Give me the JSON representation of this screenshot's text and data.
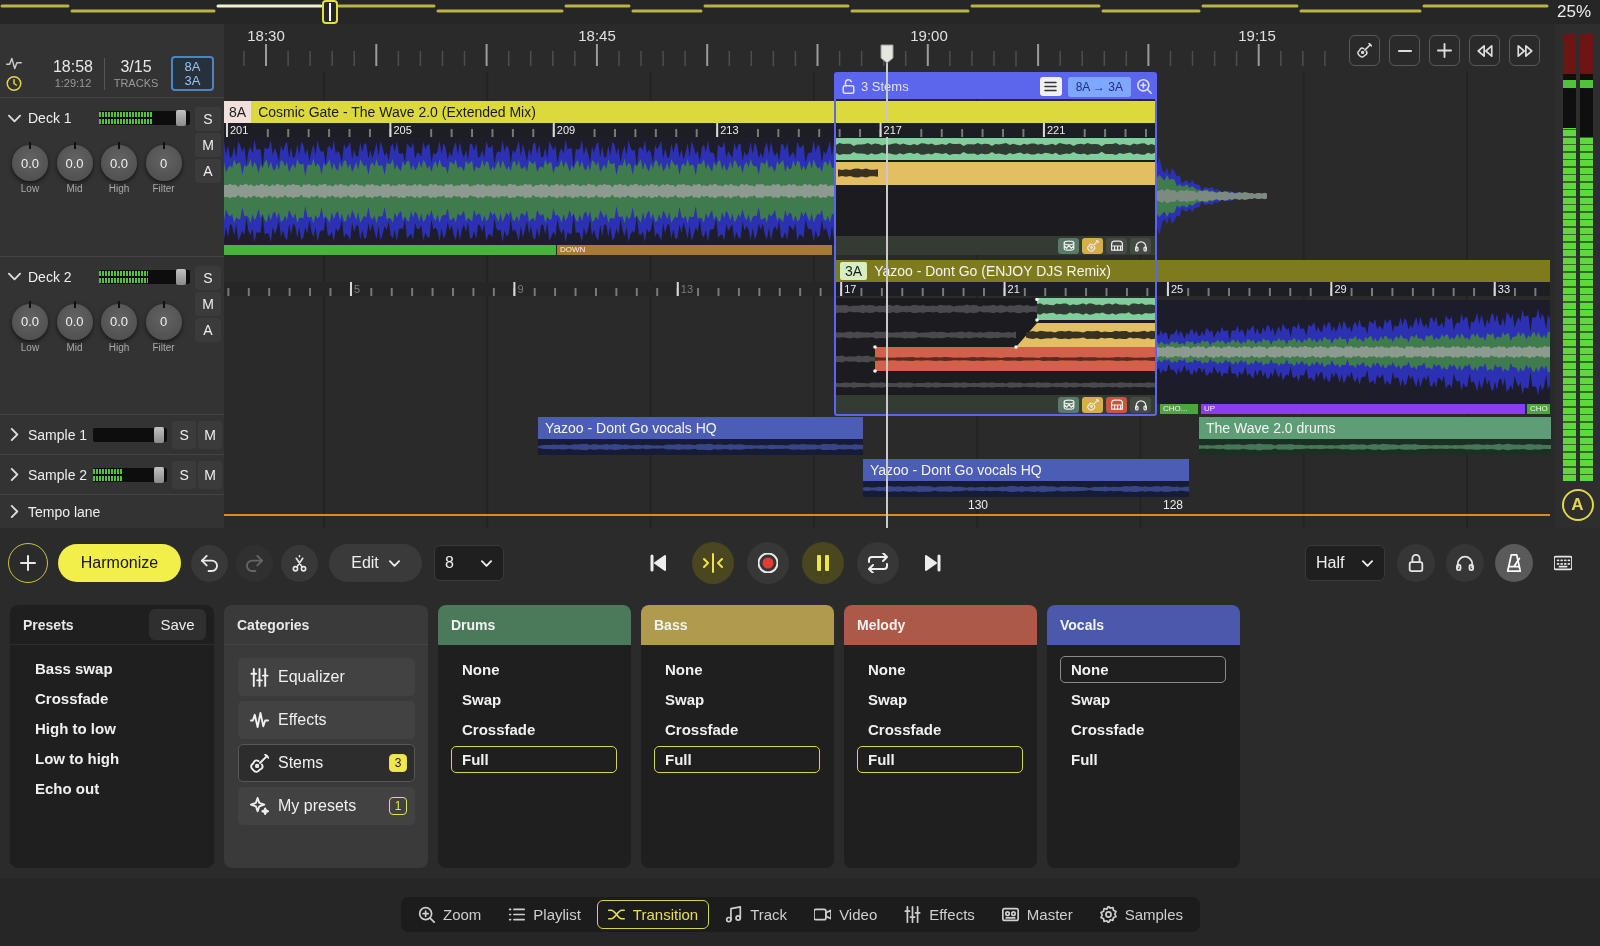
{
  "overview": {
    "zoom": "25%"
  },
  "session": {
    "clock": "18:58",
    "elapsed": "1:29:12",
    "track_count": "3/15",
    "track_label": "TRACKS",
    "keys": [
      "8A",
      "3A"
    ]
  },
  "lanes": [
    {
      "kind": "deck",
      "name": "Deck 1",
      "expanded": true,
      "meter": {
        "level": 0.66
      },
      "fader": {
        "level": 0.95
      },
      "buttons": [
        "S",
        "M",
        "A"
      ],
      "knobs": [
        {
          "value": "0.0",
          "label": "Low"
        },
        {
          "value": "0.0",
          "label": "Mid"
        },
        {
          "value": "0.0",
          "label": "High"
        },
        {
          "value": "0",
          "label": "Filter"
        }
      ]
    },
    {
      "kind": "deck",
      "name": "Deck 2",
      "expanded": true,
      "meter": {
        "level": 0.61
      },
      "fader": {
        "level": 0.95
      },
      "buttons": [
        "S",
        "M",
        "A"
      ],
      "knobs": [
        {
          "value": "0.0",
          "label": "Low"
        },
        {
          "value": "0.0",
          "label": "Mid"
        },
        {
          "value": "0.0",
          "label": "High"
        },
        {
          "value": "0",
          "label": "Filter"
        }
      ]
    },
    {
      "kind": "sample",
      "name": "Sample 1",
      "expanded": false,
      "fader": {
        "level": 0.95
      },
      "buttons": [
        "S",
        "M"
      ]
    },
    {
      "kind": "sample",
      "name": "Sample 2",
      "expanded": false,
      "meter": {
        "level": 0.46
      },
      "fader": {
        "level": 0.95
      },
      "buttons": [
        "S",
        "M"
      ]
    },
    {
      "kind": "tempo",
      "name": "Tempo lane",
      "expanded": false
    }
  ],
  "timeline": {
    "times": [
      "18:30",
      "18:45",
      "19:00",
      "19:15"
    ],
    "decks": [
      {
        "key": {
          "text": "8A",
          "color": "#f2e0dc"
        },
        "title": "Cosmic Gate - The Wave 2.0 (Extended Mix)",
        "color": "#dcd93c",
        "bars": [
          "201",
          "205",
          "209",
          "213",
          "217",
          "221"
        ],
        "sections": [
          {
            "color": "#48b43a"
          },
          {
            "label": "DOWN",
            "color": "#a77b35"
          }
        ],
        "stem_toggles": [
          {
            "on": true
          },
          {
            "on": true
          },
          {
            "on": false
          },
          {
            "on": false
          }
        ]
      },
      {
        "key": {
          "text": "3A",
          "color": "#d6efc2"
        },
        "title": "Yazoo - Dont Go (ENJOY DJS Remix)",
        "color": "#7e7b1e",
        "bars": [
          "5",
          "9",
          "13",
          "17",
          "21",
          "25",
          "29",
          "33"
        ],
        "sections": [
          {
            "label": "CHO...",
            "color": "#4ba63c"
          },
          {
            "label": "UP",
            "color": "#8b3df2"
          },
          {
            "label": "CHO",
            "color": "#4ba63c"
          }
        ],
        "stem_toggles": [
          {
            "on": true
          },
          {
            "on": true
          },
          {
            "on": true
          },
          {
            "on": false
          }
        ]
      }
    ],
    "transition": {
      "title": "3 Stems",
      "keys": "8A → 3A"
    },
    "samples": [
      {
        "clips": [
          {
            "title": "Yazoo - Dont Go vocals HQ",
            "color": "#4b5db4"
          },
          {
            "title": "The Wave 2.0 drums",
            "color": "#5e9d75"
          }
        ]
      },
      {
        "clips": [
          {
            "title": "Yazoo - Dont Go vocals HQ",
            "color": "#4b5db4"
          }
        ]
      }
    ],
    "tempo": [
      "130",
      "128"
    ]
  },
  "master_meter": [
    {
      "level": 0.79
    },
    {
      "level": 0.77
    }
  ],
  "master": {
    "auto": "A"
  },
  "toolbar": {
    "harmonize": "Harmonize",
    "history": [
      {
        "disabled": false
      },
      {
        "disabled": true
      }
    ],
    "edit_menu": "Edit",
    "quantize": "8",
    "transport": [
      {
        "on": false
      },
      {
        "on": true
      },
      {
        "on": false
      },
      {
        "on": true
      },
      {
        "on": false
      },
      {
        "on": false
      }
    ],
    "tempo_mode": "Half",
    "toggles": [
      {
        "on": false
      },
      {
        "on": false
      },
      {
        "on": true
      },
      {
        "on": false
      }
    ]
  },
  "presets": {
    "title": "Presets",
    "save": "Save",
    "items": [
      "Bass swap",
      "Crossfade",
      "High to low",
      "Low to high",
      "Echo out"
    ]
  },
  "categories": {
    "title": "Categories",
    "items": [
      {
        "label": "Equalizer",
        "selected": false
      },
      {
        "label": "Effects",
        "selected": false
      },
      {
        "label": "Stems",
        "selected": true,
        "badge": "3"
      },
      {
        "label": "My presets",
        "selected": false,
        "badge": "1"
      }
    ]
  },
  "stems": [
    {
      "name": "Drums",
      "color": "#4b7a5b",
      "options": [
        {
          "label": "None",
          "selected": false
        },
        {
          "label": "Swap",
          "selected": false
        },
        {
          "label": "Crossfade",
          "selected": false
        },
        {
          "label": "Full",
          "selected": true
        }
      ]
    },
    {
      "name": "Bass",
      "color": "#b09a4e",
      "options": [
        {
          "label": "None",
          "selected": false
        },
        {
          "label": "Swap",
          "selected": false
        },
        {
          "label": "Crossfade",
          "selected": false
        },
        {
          "label": "Full",
          "selected": true
        }
      ]
    },
    {
      "name": "Melody",
      "color": "#ad5947",
      "options": [
        {
          "label": "None",
          "selected": false
        },
        {
          "label": "Swap",
          "selected": false
        },
        {
          "label": "Crossfade",
          "selected": false
        },
        {
          "label": "Full",
          "selected": true
        }
      ]
    },
    {
      "name": "Vocals",
      "color": "#4a59ab",
      "options": [
        {
          "label": "None",
          "selected": true
        },
        {
          "label": "Swap",
          "selected": false
        },
        {
          "label": "Crossfade",
          "selected": false
        },
        {
          "label": "Full",
          "selected": false
        }
      ]
    }
  ],
  "nav": [
    {
      "label": "Zoom",
      "selected": false
    },
    {
      "label": "Playlist",
      "selected": false
    },
    {
      "label": "Transition",
      "selected": true
    },
    {
      "label": "Track",
      "selected": false
    },
    {
      "label": "Video",
      "selected": false
    },
    {
      "label": "Effects",
      "selected": false
    },
    {
      "label": "Master",
      "selected": false
    },
    {
      "label": "Samples",
      "selected": false
    }
  ]
}
